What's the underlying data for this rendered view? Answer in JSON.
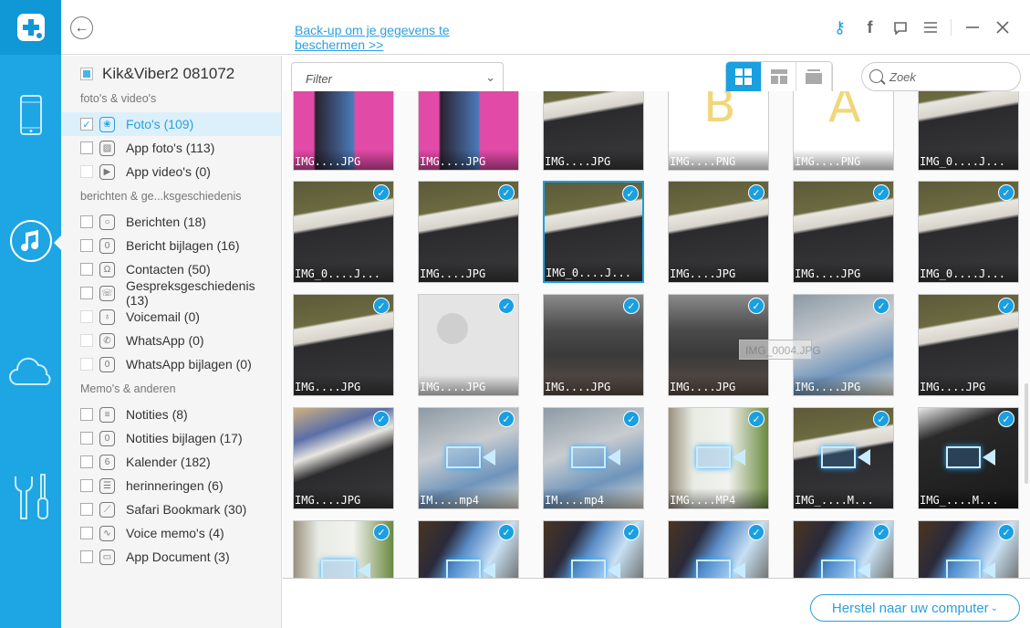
{
  "app": {
    "brand_color": "#1ea5e3",
    "accent": "#1a9fe0"
  },
  "rail": {
    "items": [
      {
        "icon": "phone-icon"
      },
      {
        "icon": "music-icon",
        "active": true
      },
      {
        "icon": "cloud-icon"
      },
      {
        "icon": "tools-icon"
      }
    ]
  },
  "header": {
    "backup_link": "Back-up om je gegevens te beschermen >>",
    "icons": [
      "key-icon",
      "facebook-icon",
      "feedback-icon",
      "menu-icon",
      "minimize-icon",
      "close-icon"
    ]
  },
  "sidebar": {
    "device": "Kik&Viber2 081072",
    "sections": [
      {
        "title": "foto's & video's",
        "items": [
          {
            "label": "Foto's (109)",
            "icon": "photos-icon",
            "checked": true,
            "selected": true
          },
          {
            "label": "App foto's (113)",
            "icon": "image-icon"
          },
          {
            "label": "App video's (0)",
            "icon": "play-icon",
            "disabled": true
          }
        ]
      },
      {
        "title": "berichten & ge...ksgeschiedenis",
        "items": [
          {
            "label": "Berichten (18)",
            "icon": "message-icon"
          },
          {
            "label": "Bericht bijlagen (16)",
            "icon": "attachment-icon"
          },
          {
            "label": "Contacten (50)",
            "icon": "contacts-icon"
          },
          {
            "label": "Gespreksgeschiedenis (13)",
            "icon": "call-history-icon"
          },
          {
            "label": "Voicemail (0)",
            "icon": "microphone-icon",
            "disabled": true
          },
          {
            "label": "WhatsApp (0)",
            "icon": "whatsapp-icon",
            "disabled": true
          },
          {
            "label": "WhatsApp bijlagen (0)",
            "icon": "attachment-icon",
            "disabled": true
          }
        ]
      },
      {
        "title": "Memo's & anderen",
        "items": [
          {
            "label": "Notities (8)",
            "icon": "notes-icon"
          },
          {
            "label": "Notities bijlagen (17)",
            "icon": "attachment-icon"
          },
          {
            "label": "Kalender (182)",
            "icon": "calendar-icon"
          },
          {
            "label": "herinneringen (6)",
            "icon": "reminders-icon"
          },
          {
            "label": "Safari Bookmark (30)",
            "icon": "compass-icon"
          },
          {
            "label": "Voice memo's (4)",
            "icon": "voice-memo-icon"
          },
          {
            "label": "App Document (3)",
            "icon": "folder-icon"
          }
        ]
      }
    ]
  },
  "toolbar": {
    "filter_placeholder": "Filter",
    "search_placeholder": "Zoek",
    "views": [
      "grid-large",
      "grid-small",
      "list"
    ],
    "active_view": "grid-large"
  },
  "grid": {
    "rows": [
      [
        {
          "c": "IMG....JPG",
          "t": "monitor-pink"
        },
        {
          "c": "IMG....JPG",
          "t": "monitor-pink"
        },
        {
          "c": "IMG....JPG",
          "t": "keyboard"
        },
        {
          "c": "IMG....PNG",
          "t": "letter",
          "l": "B"
        },
        {
          "c": "IMG....PNG",
          "t": "letter",
          "l": "A"
        },
        {
          "c": "IMG_0....J...",
          "t": "keyboard"
        }
      ],
      [
        {
          "c": "IMG_0....J...",
          "t": "keyboard",
          "k": true
        },
        {
          "c": "IMG....JPG",
          "t": "keyboard",
          "k": true
        },
        {
          "c": "IMG_0....J...",
          "t": "keyboard",
          "k": true,
          "s": true
        },
        {
          "c": "IMG....JPG",
          "t": "keyboard",
          "k": true
        },
        {
          "c": "IMG....JPG",
          "t": "keyboard",
          "k": true
        },
        {
          "c": "IMG_0....J...",
          "t": "keyboard",
          "k": true
        }
      ],
      [
        {
          "c": "IMG....JPG",
          "t": "keyboard",
          "k": true
        },
        {
          "c": "IMG....JPG",
          "t": "placeholder",
          "k": true
        },
        {
          "c": "IMG....JPG",
          "t": "figure",
          "k": true
        },
        {
          "c": "IMG....JPG",
          "t": "figure",
          "k": true
        },
        {
          "c": "IMG....JPG",
          "t": "office",
          "k": true
        },
        {
          "c": "IMG....JPG",
          "t": "keyboard",
          "k": true
        }
      ],
      [
        {
          "c": "IMG....JPG",
          "t": "desk",
          "k": true
        },
        {
          "c": "IM....mp4",
          "t": "office",
          "k": true,
          "v": true
        },
        {
          "c": "IM....mp4",
          "t": "office",
          "k": true,
          "v": true
        },
        {
          "c": "IMG....MP4",
          "t": "vase",
          "k": true,
          "v": true
        },
        {
          "c": "IMG_....M...",
          "t": "keyboard",
          "k": true,
          "v": true
        },
        {
          "c": "IMG_....M...",
          "t": "phone",
          "k": true,
          "v": true
        }
      ],
      [
        {
          "c": "",
          "t": "vase",
          "k": true,
          "v": true
        },
        {
          "c": "",
          "t": "screen",
          "k": true,
          "v": true
        },
        {
          "c": "",
          "t": "screen",
          "k": true,
          "v": true
        },
        {
          "c": "",
          "t": "screen",
          "k": true,
          "v": true
        },
        {
          "c": "",
          "t": "screen",
          "k": true,
          "v": true
        },
        {
          "c": "",
          "t": "screen",
          "k": true,
          "v": true
        }
      ]
    ],
    "tooltip": "IMG_0004.JPG"
  },
  "footer": {
    "restore_label": "Herstel naar uw computer"
  }
}
